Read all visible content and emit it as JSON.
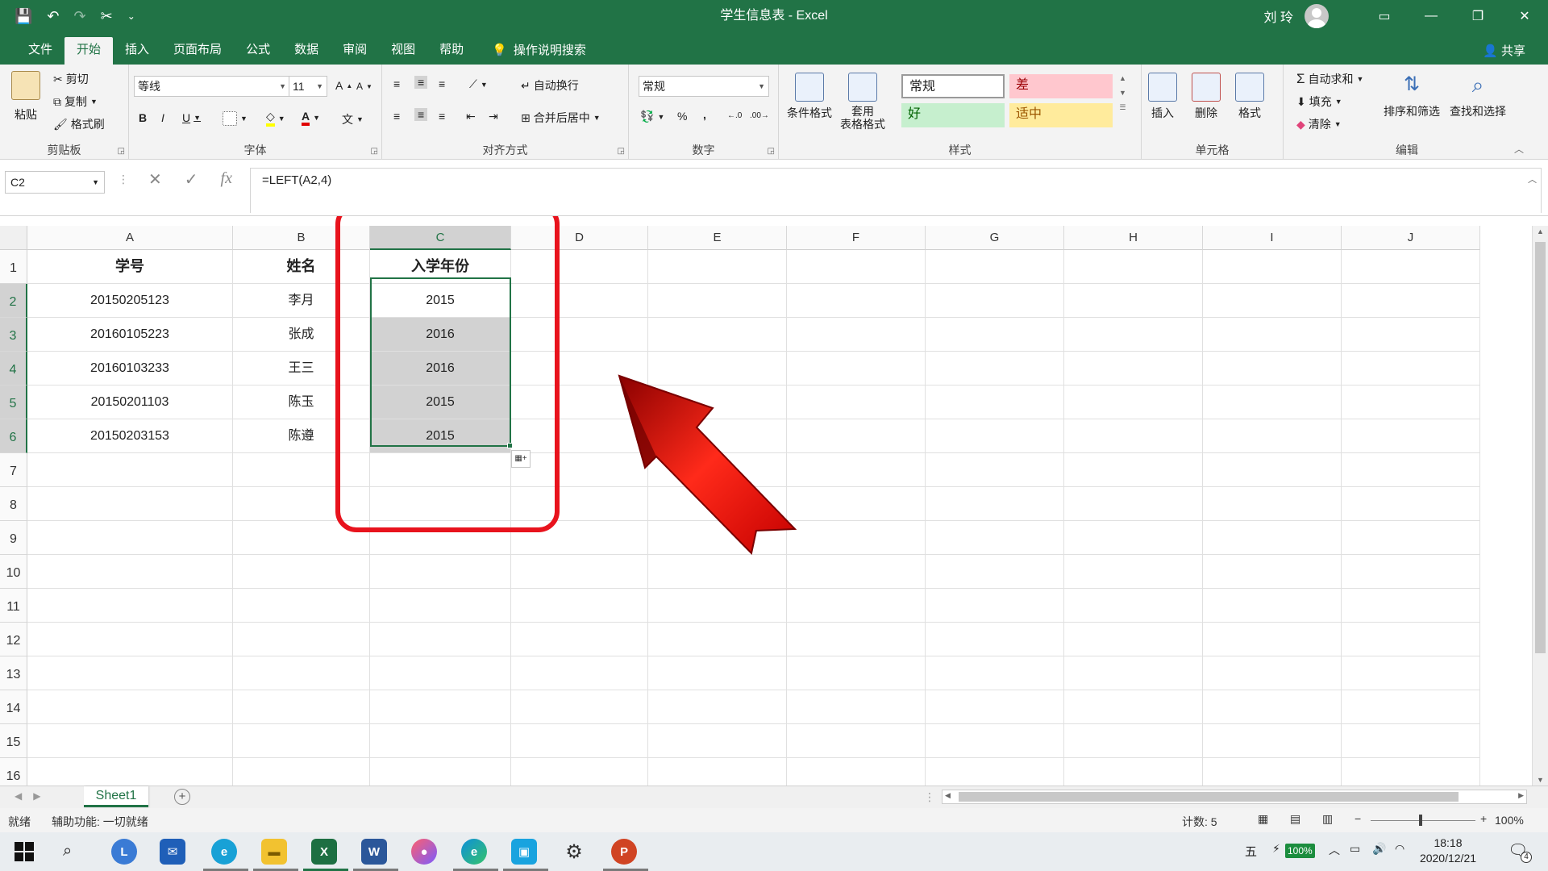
{
  "window": {
    "title": "学生信息表 - Excel",
    "user": "刘 玲"
  },
  "qat": {
    "save": "💾",
    "undo": "↶",
    "redo": "↷",
    "cut": "✂",
    "more": "⌄"
  },
  "tabs": [
    "文件",
    "开始",
    "插入",
    "页面布局",
    "公式",
    "数据",
    "审阅",
    "视图",
    "帮助"
  ],
  "tell_me": "操作说明搜索",
  "share": "共享",
  "ribbon": {
    "clipboard": {
      "label": "剪贴板",
      "paste": "粘贴",
      "cut": "剪切",
      "copy": "复制",
      "format_painter": "格式刷"
    },
    "font": {
      "label": "字体",
      "name": "等线",
      "size": "11",
      "grow": "A",
      "shrink": "A",
      "bold": "B",
      "italic": "I",
      "underline": "U",
      "phonetic": "文"
    },
    "alignment": {
      "label": "对齐方式",
      "wrap": "自动换行",
      "merge": "合并后居中"
    },
    "number": {
      "label": "数字",
      "format": "常规",
      "percent": "%",
      "comma": ","
    },
    "styles": {
      "label": "样式",
      "conditional": "条件格式",
      "table_line1": "套用",
      "table_line2": "表格格式",
      "normal": "常规",
      "bad": "差",
      "good": "好",
      "neutral": "适中"
    },
    "cells": {
      "label": "单元格",
      "insert": "插入",
      "delete": "删除",
      "format": "格式"
    },
    "editing": {
      "label": "编辑",
      "autosum": "自动求和",
      "fill": "填充",
      "clear": "清除",
      "sort": "排序和筛选",
      "find": "查找和选择"
    }
  },
  "formula_bar": {
    "name_box": "C2",
    "cancel": "✕",
    "enter": "✓",
    "fx": "fx",
    "formula": "=LEFT(A2,4)"
  },
  "grid": {
    "columns": [
      "A",
      "B",
      "C",
      "D",
      "E",
      "F",
      "G",
      "H",
      "I",
      "J"
    ],
    "row_numbers": [
      "1",
      "2",
      "3",
      "4",
      "5",
      "6",
      "7",
      "8",
      "9",
      "10",
      "11",
      "12",
      "13",
      "14",
      "15",
      "16"
    ],
    "header": [
      "学号",
      "姓名",
      "入学年份"
    ],
    "rows": [
      [
        "20150205123",
        "李月",
        "2015"
      ],
      [
        "20160105223",
        "张成",
        "2016"
      ],
      [
        "20160103233",
        "王三",
        "2016"
      ],
      [
        "20150201103",
        "陈玉",
        "2015"
      ],
      [
        "20150203153",
        "陈遵",
        "2015"
      ]
    ]
  },
  "sheets": [
    "Sheet1"
  ],
  "status": {
    "ready": "就绪",
    "accessibility": "辅助功能: 一切就绪",
    "count_label": "计数: 5",
    "zoom": "100%"
  },
  "taskbar": {
    "ime": "五",
    "battery": "100%",
    "time": "18:18",
    "date": "2020/12/21",
    "notifications": "4"
  },
  "colors": {
    "excel_green": "#217346",
    "highlight_red": "#e8131d",
    "selection_gray": "#d2d2d2"
  }
}
